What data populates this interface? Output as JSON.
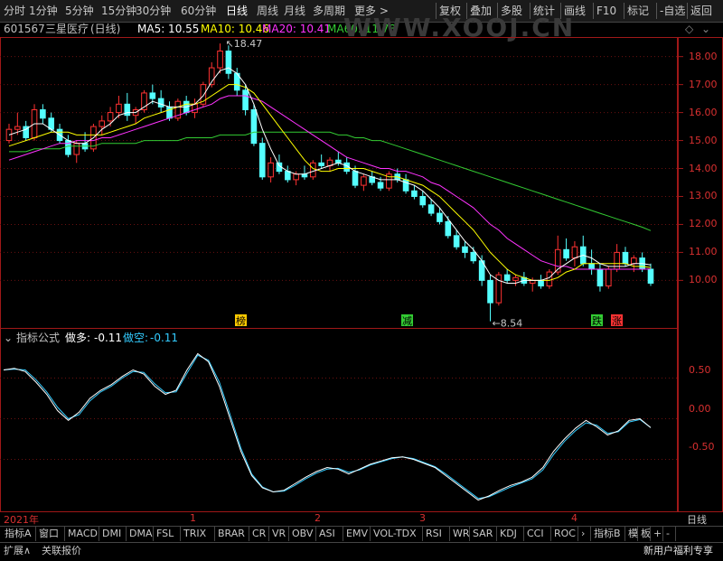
{
  "toolbar": {
    "periods": [
      "分时",
      "1分钟",
      "5分钟",
      "15分钟",
      "30分钟",
      "60分钟",
      "日线",
      "周线",
      "月线",
      "多周期",
      "更多 >"
    ],
    "active": "日线",
    "actions": [
      "复权",
      "叠加",
      "多股",
      "统计",
      "画线",
      "F10",
      "标记",
      "-自选",
      "返回"
    ]
  },
  "stock": {
    "code": "601567",
    "name": "三星医疗",
    "period": "(日线)",
    "watermark": "WWW.XOOJ.CN"
  },
  "ma": [
    {
      "label": "MA5: 10.55",
      "color": "#ffffff"
    },
    {
      "label": "MA10: 10.46",
      "color": "#ffff00"
    },
    {
      "label": "MA20: 10.41",
      "color": "#ff33ff"
    },
    {
      "label": "MA60: 11.78",
      "color": "#33cc33"
    }
  ],
  "price_axis": [
    "18.00",
    "17.00",
    "16.00",
    "15.00",
    "14.00",
    "13.00",
    "12.00",
    "11.00",
    "10.00"
  ],
  "high_label": "18.47",
  "low_label": "8.54",
  "event_marks": [
    {
      "text": "榜",
      "bg": "#ffcc00"
    },
    {
      "text": "减",
      "bg": "#33cc33"
    },
    {
      "text": "跌",
      "bg": "#33cc33"
    },
    {
      "text": "涨",
      "bg": "#ff3333"
    }
  ],
  "indicator": {
    "title": "指标公式",
    "long_label": "做多:",
    "long_value": "-0.11",
    "short_label": "做空:",
    "short_value": "-0.11",
    "axis": [
      "0.50",
      "0.00",
      "-0.50"
    ]
  },
  "time_axis": [
    "2021年",
    "1",
    "2",
    "3",
    "4"
  ],
  "period_label": "日线",
  "tabs": [
    "指标A",
    "窗口",
    "MACD",
    "DMI",
    "DMA",
    "FSL",
    "TRIX",
    "BRAR",
    "CR",
    "VR",
    "OBV",
    "ASI",
    "EMV",
    "VOL-TDX",
    "RSI",
    "WR",
    "SAR",
    "KDJ",
    "CCI",
    "ROC",
    "›",
    "指标B",
    "模",
    "板",
    "+",
    "-"
  ],
  "status": {
    "expand": "扩展∧",
    "related": "关联报价",
    "promo": "新用户福利专享"
  },
  "chart_data": {
    "type": "candlestick",
    "y_range": [
      8.3,
      18.7
    ],
    "candles": [
      [
        15.0,
        15.6,
        14.9,
        15.4
      ],
      [
        15.4,
        16.0,
        15.2,
        15.5
      ],
      [
        15.5,
        15.7,
        15.0,
        15.1
      ],
      [
        15.1,
        16.3,
        15.0,
        16.1
      ],
      [
        16.1,
        16.3,
        15.6,
        15.8
      ],
      [
        15.8,
        16.0,
        15.3,
        15.4
      ],
      [
        15.4,
        15.6,
        14.9,
        15.0
      ],
      [
        15.0,
        15.2,
        14.4,
        14.5
      ],
      [
        14.5,
        15.0,
        14.2,
        14.9
      ],
      [
        14.9,
        15.3,
        14.6,
        14.7
      ],
      [
        14.7,
        15.6,
        14.6,
        15.5
      ],
      [
        15.5,
        15.9,
        15.2,
        15.7
      ],
      [
        15.7,
        16.2,
        15.5,
        16.0
      ],
      [
        16.0,
        16.6,
        15.8,
        16.3
      ],
      [
        16.3,
        16.7,
        15.7,
        15.9
      ],
      [
        15.9,
        16.2,
        15.6,
        16.1
      ],
      [
        16.1,
        16.8,
        16.0,
        16.7
      ],
      [
        16.7,
        17.0,
        16.3,
        16.5
      ],
      [
        16.5,
        16.8,
        16.0,
        16.2
      ],
      [
        16.2,
        16.4,
        15.7,
        15.8
      ],
      [
        15.8,
        16.5,
        15.7,
        16.4
      ],
      [
        16.4,
        16.6,
        15.9,
        16.0
      ],
      [
        16.0,
        16.5,
        15.8,
        16.3
      ],
      [
        16.3,
        17.1,
        16.2,
        17.0
      ],
      [
        17.0,
        17.8,
        16.9,
        17.6
      ],
      [
        17.6,
        18.47,
        17.4,
        18.2
      ],
      [
        18.2,
        18.4,
        17.2,
        17.4
      ],
      [
        17.4,
        17.6,
        16.6,
        16.8
      ],
      [
        16.8,
        17.0,
        15.9,
        16.1
      ],
      [
        16.1,
        16.3,
        14.8,
        14.9
      ],
      [
        14.9,
        15.1,
        13.6,
        13.7
      ],
      [
        13.7,
        14.4,
        13.5,
        14.2
      ],
      [
        14.2,
        14.5,
        13.8,
        13.9
      ],
      [
        13.9,
        14.1,
        13.5,
        13.6
      ],
      [
        13.6,
        13.9,
        13.4,
        13.8
      ],
      [
        13.8,
        14.1,
        13.6,
        13.7
      ],
      [
        13.7,
        14.3,
        13.6,
        14.2
      ],
      [
        14.2,
        14.5,
        14.0,
        14.1
      ],
      [
        14.1,
        14.4,
        13.9,
        14.3
      ],
      [
        14.3,
        14.6,
        14.1,
        14.2
      ],
      [
        14.2,
        14.4,
        13.8,
        13.9
      ],
      [
        13.9,
        14.1,
        13.3,
        13.4
      ],
      [
        13.4,
        13.8,
        13.2,
        13.7
      ],
      [
        13.7,
        13.9,
        13.4,
        13.5
      ],
      [
        13.5,
        13.7,
        13.2,
        13.3
      ],
      [
        13.3,
        13.9,
        13.2,
        13.8
      ],
      [
        13.8,
        14.0,
        13.5,
        13.6
      ],
      [
        13.6,
        13.8,
        13.1,
        13.2
      ],
      [
        13.2,
        13.4,
        12.9,
        13.0
      ],
      [
        13.0,
        13.2,
        12.6,
        12.7
      ],
      [
        12.7,
        12.9,
        12.3,
        12.4
      ],
      [
        12.4,
        12.6,
        12.0,
        12.1
      ],
      [
        12.1,
        12.3,
        11.5,
        11.6
      ],
      [
        11.6,
        11.8,
        11.1,
        11.2
      ],
      [
        11.2,
        11.4,
        10.8,
        11.0
      ],
      [
        11.0,
        11.2,
        10.6,
        10.7
      ],
      [
        10.7,
        10.9,
        9.8,
        10.0
      ],
      [
        10.0,
        10.2,
        8.54,
        9.2
      ],
      [
        9.2,
        10.3,
        9.1,
        10.2
      ],
      [
        10.2,
        10.4,
        9.9,
        10.0
      ],
      [
        10.0,
        10.2,
        9.8,
        10.1
      ],
      [
        10.1,
        10.3,
        9.8,
        9.9
      ],
      [
        9.9,
        10.1,
        9.6,
        10.0
      ],
      [
        10.0,
        10.2,
        9.7,
        9.8
      ],
      [
        9.8,
        10.4,
        9.7,
        10.3
      ],
      [
        10.3,
        11.6,
        10.2,
        11.1
      ],
      [
        11.1,
        11.5,
        10.7,
        10.8
      ],
      [
        10.8,
        11.4,
        10.5,
        11.2
      ],
      [
        11.2,
        11.6,
        10.5,
        10.6
      ],
      [
        10.6,
        11.1,
        10.2,
        10.4
      ],
      [
        10.4,
        10.6,
        9.6,
        9.8
      ],
      [
        9.8,
        10.5,
        9.7,
        10.4
      ],
      [
        10.4,
        11.3,
        10.3,
        11.0
      ],
      [
        11.0,
        11.2,
        10.5,
        10.6
      ],
      [
        10.6,
        10.9,
        10.3,
        10.8
      ],
      [
        10.8,
        11.0,
        10.3,
        10.4
      ],
      [
        10.4,
        10.6,
        9.8,
        9.9
      ]
    ],
    "ma5": [
      15.2,
      15.3,
      15.4,
      15.6,
      15.6,
      15.4,
      15.2,
      15.0,
      14.9,
      14.9,
      15.1,
      15.4,
      15.6,
      15.9,
      16.0,
      16.0,
      16.2,
      16.4,
      16.3,
      16.2,
      16.2,
      16.2,
      16.3,
      16.6,
      17.1,
      17.5,
      17.6,
      17.4,
      17.0,
      16.3,
      15.4,
      14.7,
      14.1,
      13.9,
      13.8,
      13.8,
      13.9,
      14.0,
      14.1,
      14.2,
      14.1,
      13.9,
      13.8,
      13.7,
      13.6,
      13.6,
      13.6,
      13.5,
      13.4,
      13.2,
      12.9,
      12.6,
      12.2,
      11.8,
      11.4,
      11.1,
      10.7,
      10.2,
      10.0,
      9.9,
      9.9,
      10.0,
      10.0,
      10.0,
      10.1,
      10.4,
      10.6,
      10.8,
      10.9,
      10.8,
      10.6,
      10.5,
      10.5,
      10.5,
      10.6,
      10.6,
      10.55
    ],
    "ma10": [
      14.8,
      14.9,
      15.0,
      15.1,
      15.2,
      15.3,
      15.3,
      15.3,
      15.2,
      15.2,
      15.2,
      15.2,
      15.3,
      15.4,
      15.5,
      15.6,
      15.8,
      15.9,
      16.0,
      16.1,
      16.2,
      16.3,
      16.3,
      16.4,
      16.6,
      16.8,
      17.0,
      17.0,
      16.9,
      16.7,
      16.3,
      15.9,
      15.5,
      15.1,
      14.7,
      14.3,
      14.0,
      13.9,
      13.9,
      14.0,
      14.0,
      14.0,
      14.0,
      13.9,
      13.8,
      13.7,
      13.7,
      13.6,
      13.5,
      13.4,
      13.2,
      13.0,
      12.7,
      12.4,
      12.1,
      11.8,
      11.4,
      11.0,
      10.7,
      10.4,
      10.2,
      10.1,
      10.0,
      10.0,
      10.0,
      10.1,
      10.3,
      10.4,
      10.6,
      10.6,
      10.6,
      10.6,
      10.6,
      10.6,
      10.5,
      10.5,
      10.46
    ],
    "ma20": [
      14.3,
      14.4,
      14.5,
      14.6,
      14.7,
      14.8,
      14.9,
      14.9,
      15.0,
      15.0,
      15.0,
      15.1,
      15.1,
      15.2,
      15.3,
      15.4,
      15.5,
      15.6,
      15.7,
      15.8,
      15.9,
      16.0,
      16.1,
      16.2,
      16.3,
      16.5,
      16.6,
      16.6,
      16.6,
      16.5,
      16.4,
      16.2,
      16.0,
      15.8,
      15.6,
      15.4,
      15.2,
      15.0,
      14.8,
      14.6,
      14.4,
      14.3,
      14.2,
      14.1,
      14.0,
      14.0,
      13.9,
      13.9,
      13.8,
      13.7,
      13.5,
      13.4,
      13.2,
      13.0,
      12.8,
      12.6,
      12.3,
      12.0,
      11.8,
      11.5,
      11.3,
      11.1,
      10.9,
      10.7,
      10.6,
      10.5,
      10.5,
      10.4,
      10.4,
      10.4,
      10.4,
      10.4,
      10.4,
      10.4,
      10.4,
      10.4,
      10.41
    ],
    "ma60": [
      14.6,
      14.6,
      14.6,
      14.7,
      14.7,
      14.7,
      14.7,
      14.8,
      14.8,
      14.8,
      14.8,
      14.9,
      14.9,
      14.9,
      14.9,
      14.9,
      15.0,
      15.0,
      15.0,
      15.0,
      15.0,
      15.1,
      15.1,
      15.1,
      15.1,
      15.2,
      15.2,
      15.2,
      15.2,
      15.3,
      15.3,
      15.3,
      15.3,
      15.3,
      15.3,
      15.3,
      15.3,
      15.3,
      15.3,
      15.2,
      15.2,
      15.1,
      15.1,
      15.0,
      15.0,
      14.9,
      14.8,
      14.7,
      14.6,
      14.5,
      14.4,
      14.3,
      14.2,
      14.1,
      14.0,
      13.9,
      13.8,
      13.7,
      13.6,
      13.5,
      13.4,
      13.3,
      13.2,
      13.1,
      13.0,
      12.9,
      12.8,
      12.7,
      12.6,
      12.5,
      12.4,
      12.3,
      12.2,
      12.1,
      12.0,
      11.9,
      11.78
    ],
    "osc_range": [
      -1.05,
      0.95
    ],
    "osc_long": [
      0.6,
      0.62,
      0.58,
      0.45,
      0.3,
      0.1,
      -0.02,
      0.08,
      0.25,
      0.35,
      0.42,
      0.52,
      0.6,
      0.55,
      0.4,
      0.3,
      0.35,
      0.6,
      0.8,
      0.7,
      0.4,
      0.0,
      -0.4,
      -0.7,
      -0.85,
      -0.9,
      -0.88,
      -0.8,
      -0.72,
      -0.65,
      -0.6,
      -0.62,
      -0.68,
      -0.62,
      -0.56,
      -0.52,
      -0.48,
      -0.47,
      -0.5,
      -0.55,
      -0.6,
      -0.7,
      -0.8,
      -0.9,
      -1.0,
      -0.95,
      -0.88,
      -0.82,
      -0.78,
      -0.72,
      -0.6,
      -0.4,
      -0.25,
      -0.12,
      -0.02,
      -0.1,
      -0.2,
      -0.15,
      -0.02,
      0.0,
      -0.11
    ],
    "osc_short": [
      0.6,
      0.61,
      0.6,
      0.48,
      0.33,
      0.14,
      0.0,
      0.05,
      0.22,
      0.33,
      0.4,
      0.5,
      0.58,
      0.57,
      0.43,
      0.32,
      0.33,
      0.56,
      0.78,
      0.72,
      0.45,
      0.05,
      -0.36,
      -0.68,
      -0.84,
      -0.9,
      -0.89,
      -0.82,
      -0.74,
      -0.67,
      -0.62,
      -0.61,
      -0.66,
      -0.63,
      -0.57,
      -0.53,
      -0.49,
      -0.47,
      -0.49,
      -0.54,
      -0.59,
      -0.68,
      -0.78,
      -0.88,
      -0.98,
      -0.96,
      -0.9,
      -0.84,
      -0.79,
      -0.74,
      -0.63,
      -0.44,
      -0.28,
      -0.15,
      -0.05,
      -0.08,
      -0.18,
      -0.16,
      -0.04,
      -0.01,
      -0.11
    ]
  }
}
